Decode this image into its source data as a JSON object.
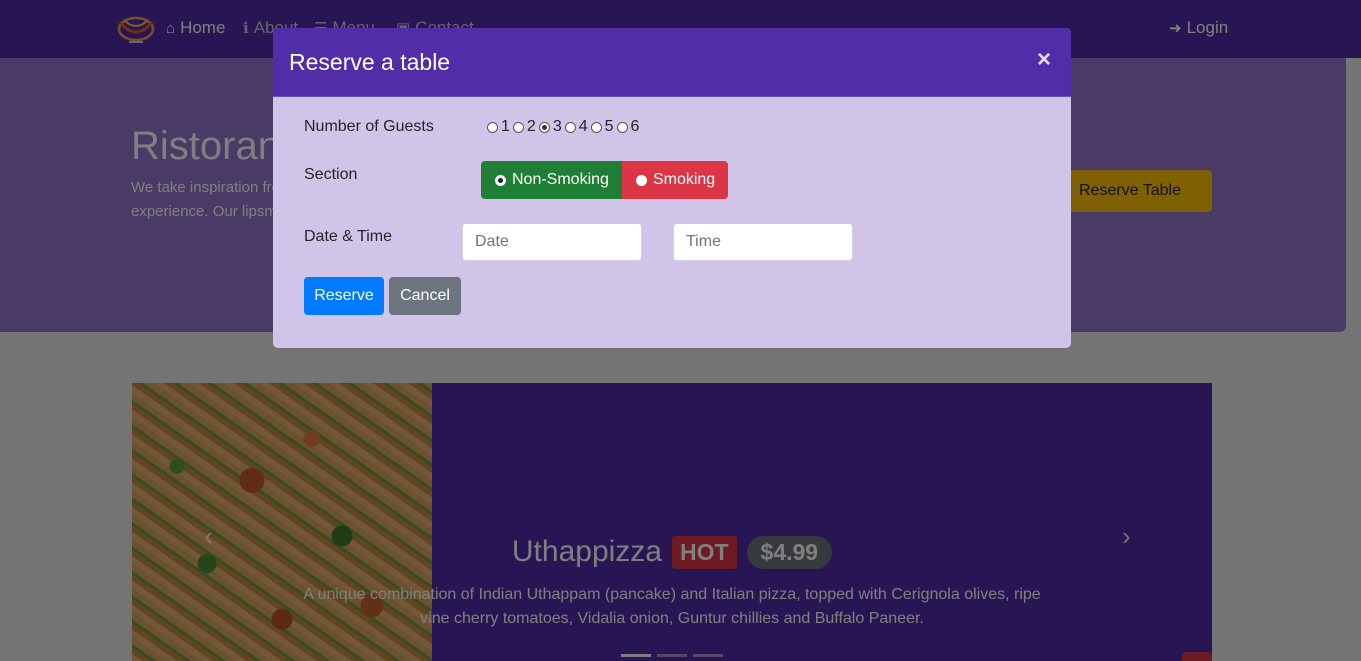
{
  "navbar": {
    "items": [
      {
        "icon": "home-icon",
        "glyph": "⌂",
        "label": "Home"
      },
      {
        "icon": "info-icon",
        "glyph": "ℹ",
        "label": "About"
      },
      {
        "icon": "list-icon",
        "glyph": "☰",
        "label": "Menu"
      },
      {
        "icon": "address-card-icon",
        "glyph": "▣",
        "label": "Contact"
      }
    ],
    "login": {
      "icon": "sign-in-icon",
      "glyph": "➜",
      "label": "Login"
    }
  },
  "jumbotron": {
    "title": "Ristorante con Fusion",
    "text": "We take inspiration from the World's best cuisines, and create a unique fusion experience. Our lipsmacking creations will tickle your culinary senses!",
    "reserve_button": "Reserve Table"
  },
  "carousel": {
    "title": "Uthappizza",
    "badge": "HOT",
    "price": "$4.99",
    "description": "A unique combination of Indian Uthappam (pancake) and Italian pizza, topped with Cerignola olives, ripe vine cherry tomatoes, Vidalia onion, Guntur chillies and Buffalo Paneer.",
    "prev_icon": "‹",
    "next_icon": "›"
  },
  "modal": {
    "title": "Reserve a table",
    "close": "×",
    "guests_label": "Number of Guests",
    "guests_options": [
      "1",
      "2",
      "3",
      "4",
      "5",
      "6"
    ],
    "guests_selected": "3",
    "section_label": "Section",
    "section_options": [
      "Non-Smoking",
      "Smoking"
    ],
    "section_selected": "Non-Smoking",
    "datetime_label": "Date & Time",
    "date_placeholder": "Date",
    "time_placeholder": "Time",
    "reserve_button": "Reserve",
    "cancel_button": "Cancel"
  },
  "colors": {
    "primary": "#512da8",
    "modal_body": "#d1c4e9",
    "warning": "#ffc107",
    "success": "#28a745",
    "danger": "#dc3545"
  }
}
